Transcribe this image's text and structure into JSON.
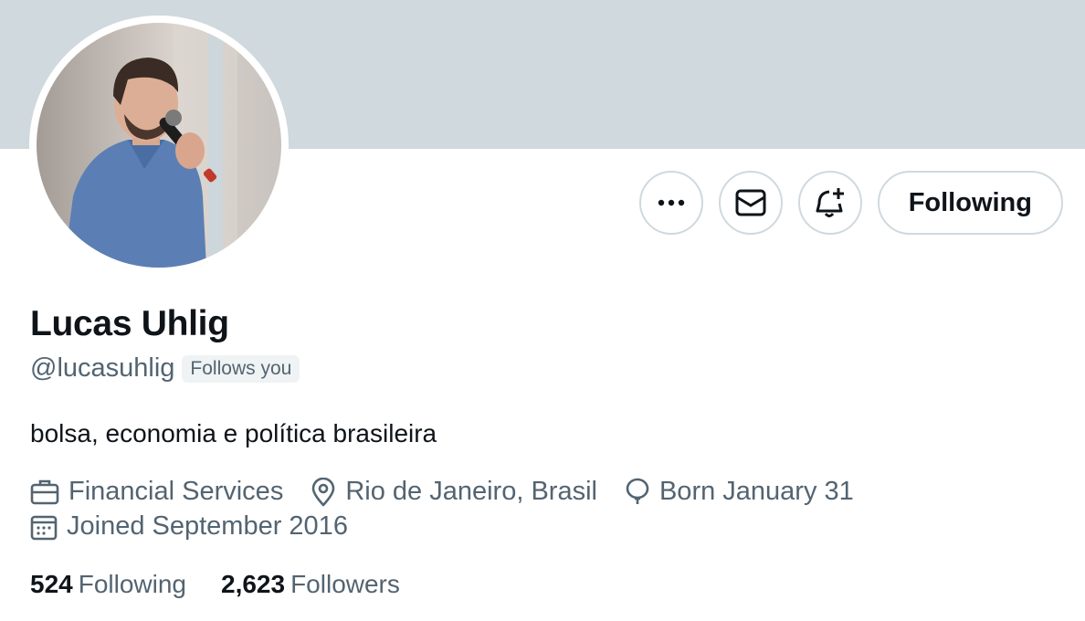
{
  "profile": {
    "name": "Lucas Uhlig",
    "handle": "@lucasuhlig",
    "follows_badge": "Follows you",
    "bio": "bolsa, economia e política brasileira"
  },
  "actions": {
    "more_icon": "more-dots-icon",
    "message_icon": "envelope-icon",
    "notify_icon": "bell-plus-icon",
    "follow_label": "Following"
  },
  "meta": {
    "category": "Financial Services",
    "location": "Rio de Janeiro, Brasil",
    "birthday": "Born January 31",
    "joined": "Joined September 2016"
  },
  "stats": {
    "following_count": "524",
    "following_label": "Following",
    "followers_count": "2,623",
    "followers_label": "Followers"
  },
  "colors": {
    "banner": "#cfd9de",
    "text_primary": "#0f1419",
    "text_secondary": "#536471",
    "border": "#cfd9de"
  }
}
